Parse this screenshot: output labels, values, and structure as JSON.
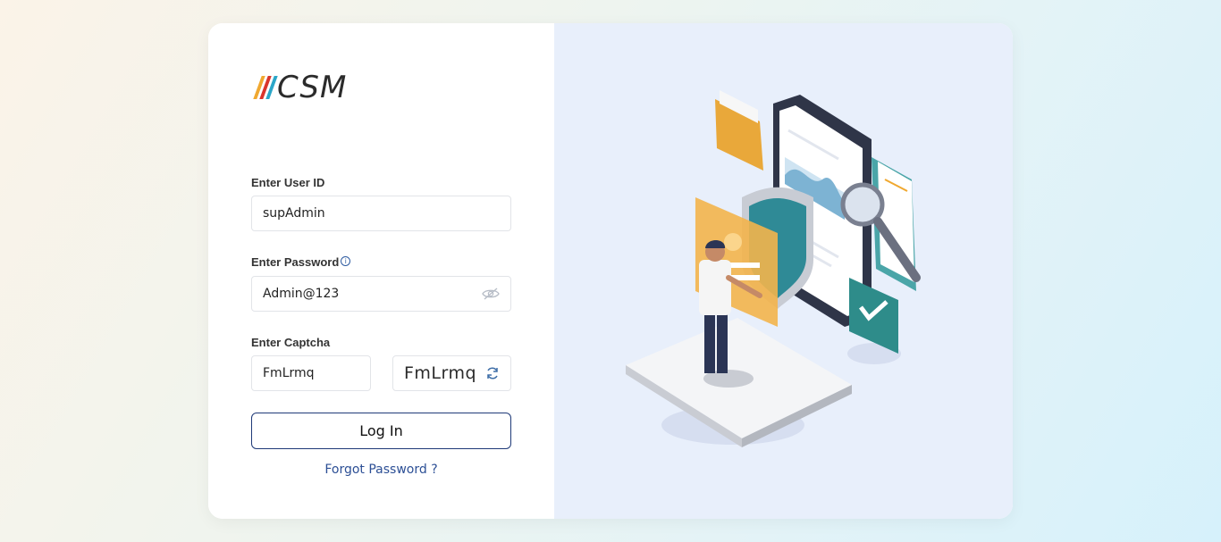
{
  "brand": {
    "logo_text": "CSM",
    "logo_bar_colors": [
      "#f0a830",
      "#d9342b",
      "#2aa6c8"
    ]
  },
  "form": {
    "user_id": {
      "label": "Enter User ID",
      "value": "supAdmin"
    },
    "password": {
      "label": "Enter Password",
      "value": "Admin@123",
      "info_icon": "info-icon",
      "toggle_icon": "eye-off-icon"
    },
    "captcha": {
      "label": "Enter Captcha",
      "value": "FmLrmq",
      "image_text": "FmLrmq",
      "refresh_icon": "refresh-icon"
    },
    "login_label": "Log In",
    "forgot_label": "Forgot Password ?"
  },
  "colors": {
    "accent": "#1f3a78",
    "link": "#2c4f95",
    "panel_bg": "#e8effb"
  }
}
